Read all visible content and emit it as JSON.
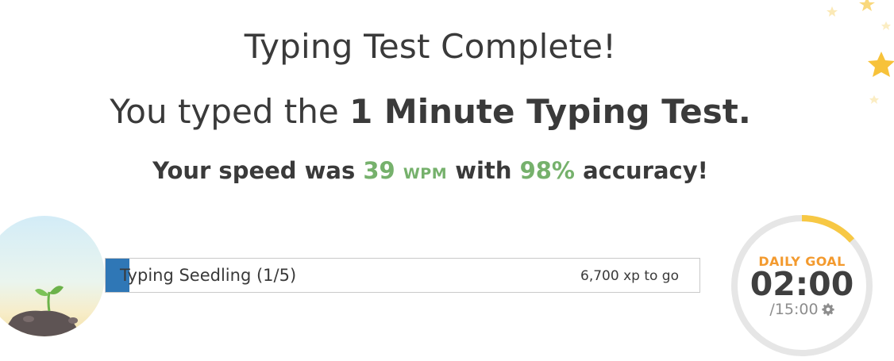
{
  "title": "Typing Test Complete!",
  "subtitle": {
    "prefix": "You typed the ",
    "test_name": "1 Minute Typing Test."
  },
  "result": {
    "prefix": "Your speed was ",
    "wpm": "39",
    "wpm_unit": "WPM",
    "middle": " with ",
    "accuracy": "98%",
    "suffix": " accuracy!"
  },
  "level": {
    "name": "Typing Seedling (1/5)",
    "xp_to_go": "6,700 xp to go",
    "progress_fraction": 0.04
  },
  "daily_goal": {
    "label": "DAILY GOAL",
    "time": "02:00",
    "total": "/15:00",
    "progress_fraction": 0.133
  },
  "colors": {
    "green": "#76b16c",
    "blue": "#2f77b6",
    "orange": "#f39a2e",
    "ring_progress": "#f7c844",
    "ring_track": "#e6e6e6"
  },
  "icons": {
    "settings": "gear-icon",
    "level_badge": "seedling-icon",
    "decoration": "star-icon"
  }
}
